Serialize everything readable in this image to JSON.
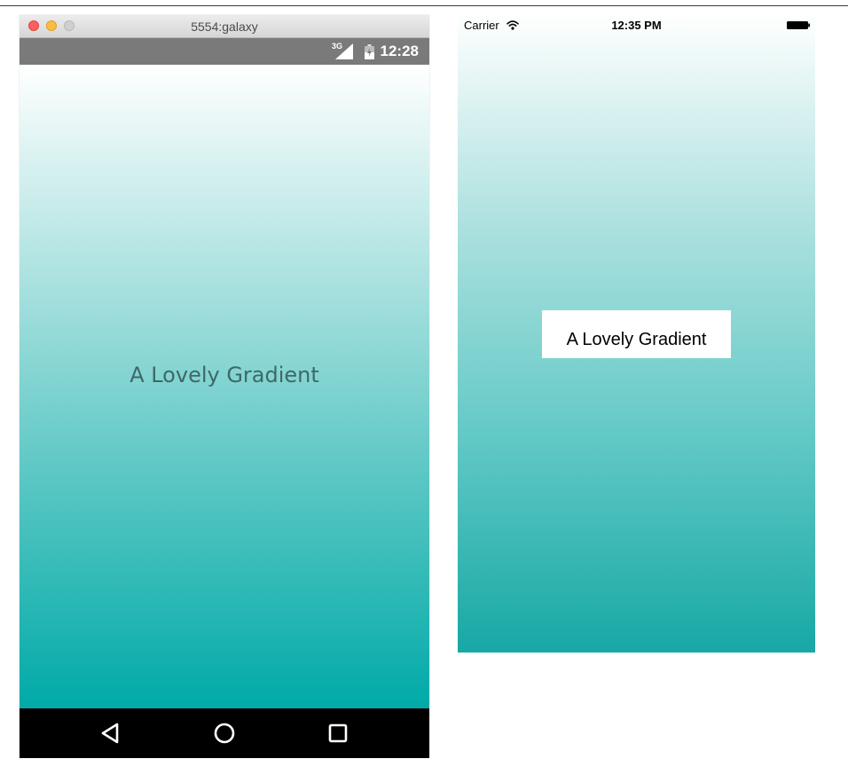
{
  "android": {
    "window_title": "5554:galaxy",
    "network_label": "3G",
    "clock": "12:28",
    "label": "A Lovely Gradient",
    "gradient": {
      "top": "#ffffff",
      "bottom": "#00aaa8"
    },
    "navbar": [
      "back",
      "home",
      "recents"
    ]
  },
  "ios": {
    "carrier": "Carrier",
    "clock": "12:35 PM",
    "label": "A Lovely Gradient",
    "gradient": {
      "top": "#ffffff",
      "bottom": "#17a8a5"
    }
  },
  "icons": {
    "close": "red-circle",
    "minimize": "yellow-circle",
    "zoom": "grey-circle",
    "signal": "cell-signal-icon",
    "battery": "battery-icon",
    "wifi": "wifi-icon",
    "back": "triangle-left",
    "home": "circle",
    "recents": "square"
  }
}
